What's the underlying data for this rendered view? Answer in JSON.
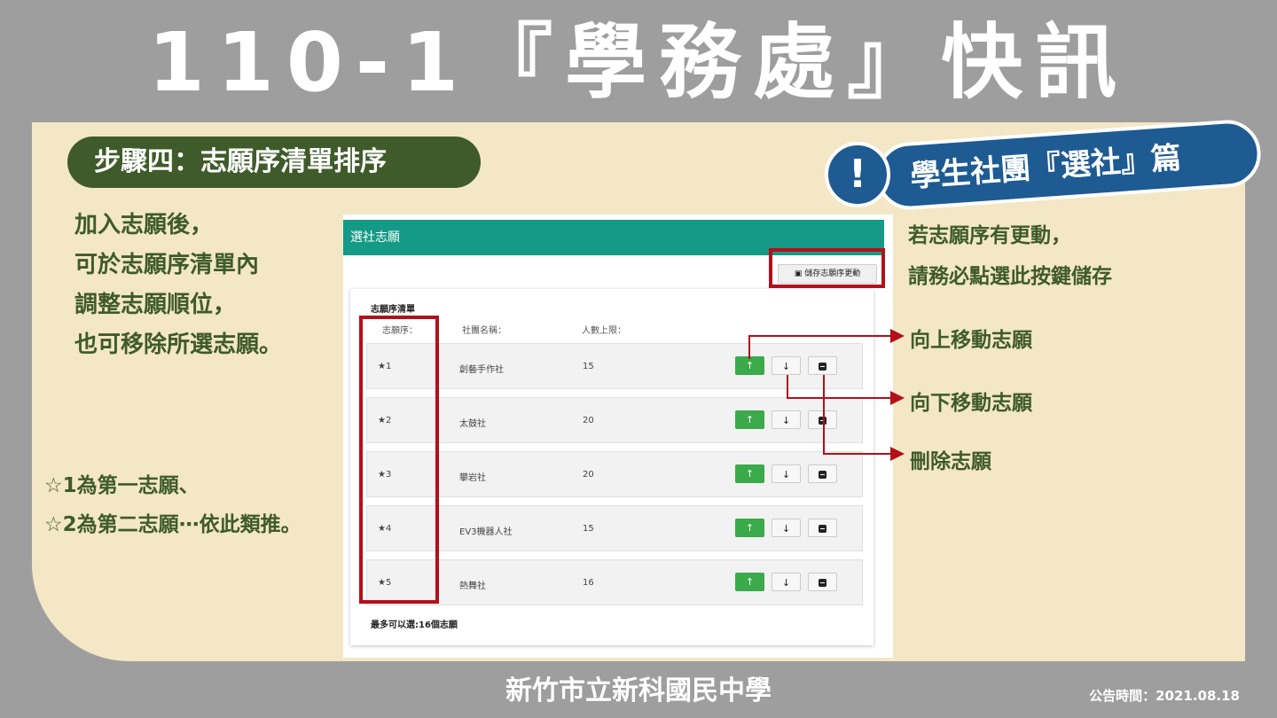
{
  "main_title": "110-1『學務處』快訊",
  "step_label": "步驟四：志願序清單排序",
  "badge": {
    "bang": "!",
    "label": "學生社團『選社』篇"
  },
  "left_instructions": [
    "加入志願後，",
    "可於志願序清單內",
    "調整志願順位，",
    "也可移除所選志願。"
  ],
  "notes": [
    "☆1為第一志願、",
    "☆2為第二志願⋯依此類推。"
  ],
  "screenshot": {
    "header": "選社志願",
    "save_button": "儲存志願序更動",
    "list_title": "志願序清單",
    "columns": [
      "志願序：",
      "社團名稱：",
      "人數上限："
    ],
    "rows": [
      {
        "rank": "★1",
        "name": "創藝手作社",
        "cap": "15"
      },
      {
        "rank": "★2",
        "name": "太鼓社",
        "cap": "20"
      },
      {
        "rank": "★3",
        "name": "攀岩社",
        "cap": "20"
      },
      {
        "rank": "★4",
        "name": "EV3機器人社",
        "cap": "15"
      },
      {
        "rank": "★5",
        "name": "熱舞社",
        "cap": "16"
      }
    ],
    "buttons": {
      "up": "↑",
      "down": "↓"
    },
    "footnote": "最多可以選:16個志願"
  },
  "right_text": [
    "若志願序有更動，",
    "請務必點選此按鍵儲存"
  ],
  "callouts": {
    "up": "向上移動志願",
    "down": "向下移動志願",
    "delete": "刪除志願"
  },
  "footer": "新竹市立新科國民中學",
  "date": "公告時間：2021.08.18",
  "colors": {
    "green_dark": "#3f5b2a",
    "blue": "#1e5b93",
    "teal": "#149a86",
    "red": "#b3101a",
    "panel": "#f3e7c6"
  }
}
